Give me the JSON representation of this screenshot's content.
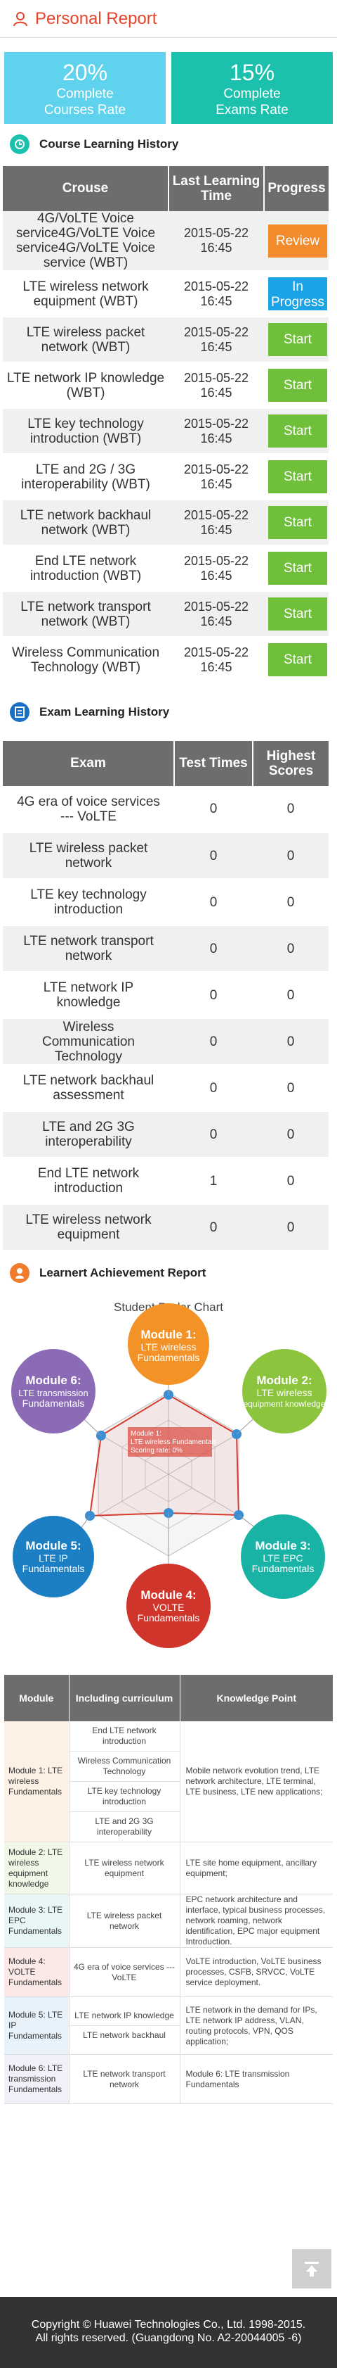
{
  "header": {
    "title": "Personal Report",
    "icon": "user-icon"
  },
  "rates": [
    {
      "percent": "20%",
      "line1": "Complete",
      "line2": "Courses Rate",
      "color": "#5fd2ee"
    },
    {
      "percent": "15%",
      "line1": "Complete",
      "line2": "Exams Rate",
      "color": "#1cc1ae"
    }
  ],
  "course_section": {
    "title": "Course Learning History",
    "icon": "history-icon",
    "color": "#1cc1ae"
  },
  "course_table": {
    "headers": {
      "course": "Crouse",
      "time": "Last Learning Time",
      "progress": "Progress"
    },
    "rows": [
      {
        "name": "4G/VoLTE Voice service4G/VoLTE Voice service4G/VoLTE Voice service (WBT)",
        "date": "2015-05-22",
        "time": "16:45",
        "action": "Review",
        "action_type": "review"
      },
      {
        "name": "LTE wireless network equipment (WBT)",
        "date": "2015-05-22",
        "time": "16:45",
        "action": "In Progress",
        "action_type": "progress"
      },
      {
        "name": "LTE wireless packet network (WBT)",
        "date": "2015-05-22",
        "time": "16:45",
        "action": "Start",
        "action_type": "start"
      },
      {
        "name": "LTE network IP knowledge (WBT)",
        "date": "2015-05-22",
        "time": "16:45",
        "action": "Start",
        "action_type": "start"
      },
      {
        "name": "LTE key technology introduction (WBT)",
        "date": "2015-05-22",
        "time": "16:45",
        "action": "Start",
        "action_type": "start"
      },
      {
        "name": "LTE and 2G / 3G interoperability (WBT)",
        "date": "2015-05-22",
        "time": "16:45",
        "action": "Start",
        "action_type": "start"
      },
      {
        "name": "LTE network backhaul network (WBT)",
        "date": "2015-05-22",
        "time": "16:45",
        "action": "Start",
        "action_type": "start"
      },
      {
        "name": "End LTE network introduction (WBT)",
        "date": "2015-05-22",
        "time": "16:45",
        "action": "Start",
        "action_type": "start"
      },
      {
        "name": "LTE network transport network (WBT)",
        "date": "2015-05-22",
        "time": "16:45",
        "action": "Start",
        "action_type": "start"
      },
      {
        "name": "Wireless Communication Technology (WBT)",
        "date": "2015-05-22",
        "time": "16:45",
        "action": "Start",
        "action_type": "start"
      }
    ]
  },
  "exam_section": {
    "title": "Exam Learning History",
    "icon": "exam-icon",
    "color": "#1a6fc4"
  },
  "exam_table": {
    "headers": {
      "exam": "Exam",
      "times": "Test Times",
      "scores": "Highest Scores"
    },
    "rows": [
      {
        "name": "4G era of voice services --- VoLTE",
        "times": "0",
        "score": "0"
      },
      {
        "name": "LTE wireless packet network",
        "times": "0",
        "score": "0"
      },
      {
        "name": "LTE key technology introduction",
        "times": "0",
        "score": "0"
      },
      {
        "name": "LTE network transport network",
        "times": "0",
        "score": "0"
      },
      {
        "name": "LTE network IP knowledge",
        "times": "0",
        "score": "0"
      },
      {
        "name": "Wireless Communication Technology",
        "times": "0",
        "score": "0"
      },
      {
        "name": "LTE network backhaul assessment",
        "times": "0",
        "score": "0"
      },
      {
        "name": "LTE and 2G 3G interoperability",
        "times": "0",
        "score": "0"
      },
      {
        "name": "End LTE network introduction",
        "times": "1",
        "score": "0"
      },
      {
        "name": "LTE wireless network equipment",
        "times": "0",
        "score": "0"
      }
    ]
  },
  "achievement_section": {
    "title": "Learnert Achievement Report",
    "icon": "achievement-icon",
    "color": "#f07b2a"
  },
  "radar": {
    "title": "Student Radar Chart",
    "tooltip": {
      "line1": "Module 1:",
      "line2": "LTE wireless Fundamentals",
      "line3": "Scoring rate:  0%"
    },
    "modules": [
      {
        "label": "Module 1:",
        "sub1": "LTE wireless",
        "sub2": "Fundamentals",
        "color": "#f39226"
      },
      {
        "label": "Module 2:",
        "sub1": "LTE wireless",
        "sub2": "equipment knowledge",
        "color": "#8cc43e"
      },
      {
        "label": "Module 3:",
        "sub1": "LTE EPC",
        "sub2": "Fundamentals",
        "color": "#19b3a6"
      },
      {
        "label": "Module 4:",
        "sub1": "VOLTE",
        "sub2": "Fundamentals",
        "color": "#d0352b"
      },
      {
        "label": "Module 5:",
        "sub1": "LTE IP",
        "sub2": "Fundamentals",
        "color": "#1c7fc4"
      },
      {
        "label": "Module 6:",
        "sub1": "LTE transmission",
        "sub2": "Fundamentals",
        "color": "#8b6bb5"
      }
    ]
  },
  "achievement_table": {
    "headers": {
      "module": "Module",
      "curriculum": "Including curriculum",
      "knowledge": "Knowledge Point"
    },
    "rows": [
      {
        "module": "Module 1: LTE wireless Fundamentals",
        "bg": "#fdf1e6",
        "curricula": [
          "End LTE network introduction",
          "Wireless Communication Technology",
          "LTE key technology introduction",
          "LTE and 2G 3G interoperability"
        ],
        "knowledge": "Mobile network evolution trend, LTE network architecture, LTE terminal, LTE business, LTE new applications;"
      },
      {
        "module": "Module 2: LTE wireless equipment knowledge",
        "bg": "#f1f8e8",
        "curricula": [
          "LTE wireless network equipment"
        ],
        "knowledge": "LTE site home equipment, ancillary equipment;"
      },
      {
        "module": "Module 3: LTE EPC Fundamentals",
        "bg": "#e8f6f5",
        "curricula": [
          "LTE wireless packet network"
        ],
        "knowledge": "EPC network architecture and interface, typical business processes, network roaming, network identification, EPC major equipment Introduction."
      },
      {
        "module": "Module 4: VOLTE Fundamentals",
        "bg": "#fbe9e8",
        "curricula": [
          "4G era of voice services --- VoLTE"
        ],
        "knowledge": "VoLTE introduction, VoLTE business processes, CSFB, SRVCC, VoLTE service deployment."
      },
      {
        "module": "Module 5: LTE IP Fundamentals",
        "bg": "#e8f2fa",
        "curricula": [
          "LTE network IP knowledge",
          "LTE network backhaul"
        ],
        "knowledge": "LTE network in the demand for IPs, LTE network IP address, VLAN, routing protocols, VPN, QOS application;"
      },
      {
        "module": "Module 6: LTE transmission Fundamentals",
        "bg": "#f3eff8",
        "curricula": [
          "LTE network transport network"
        ],
        "knowledge": "Module 6: LTE transmission Fundamentals"
      }
    ]
  },
  "footer": {
    "line1": "Copyright © Huawei Technologies Co., Ltd. 1998-2015.",
    "line2": "All rights reserved. (Guangdong No. A2-20044005 -6)",
    "scroll_top_icon": "arrow-up-icon"
  }
}
